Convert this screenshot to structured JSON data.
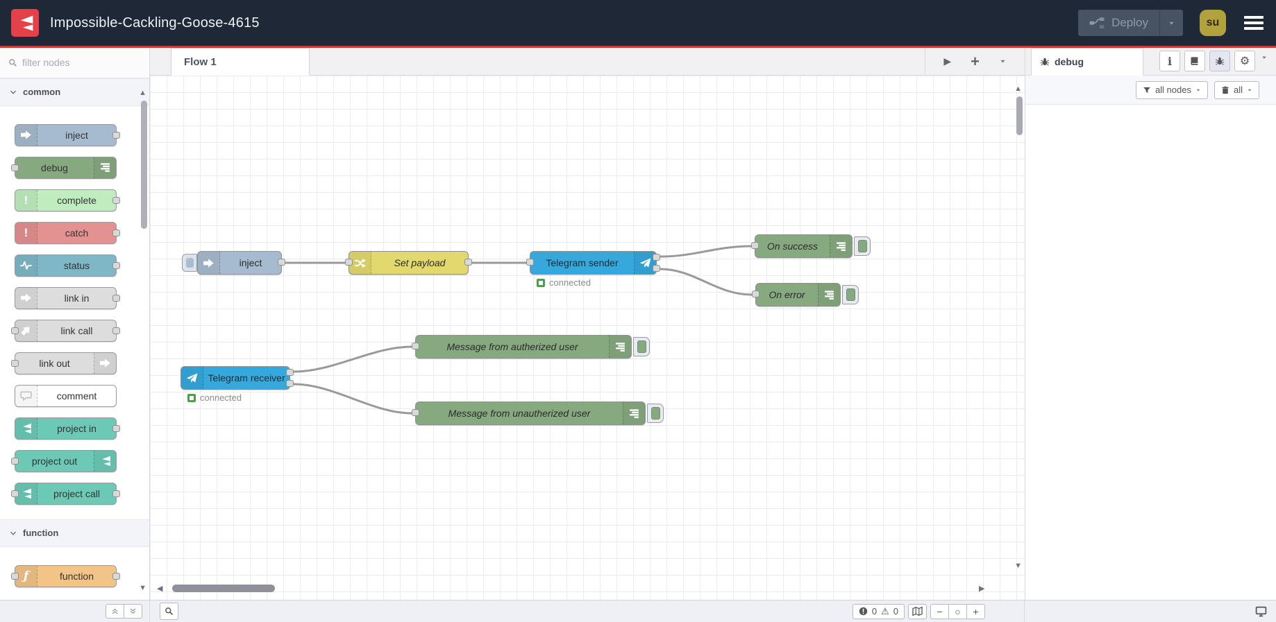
{
  "header": {
    "title": "Impossible-Cackling-Goose-4615",
    "deploy": {
      "label": "Deploy"
    },
    "avatar": {
      "initials": "su"
    }
  },
  "palette": {
    "filter_placeholder": "filter nodes",
    "categories": [
      {
        "label": "common",
        "nodes": [
          {
            "label": "inject",
            "color": "#a6bbcf",
            "icon": "inject-arrow-icon"
          },
          {
            "label": "debug",
            "color": "#87a980",
            "icon": "debug-list-icon"
          },
          {
            "label": "complete",
            "color": "#c0edc0",
            "icon": "exclamation-icon"
          },
          {
            "label": "catch",
            "color": "#e49191",
            "icon": "exclamation-icon"
          },
          {
            "label": "status",
            "color": "#7fb7c7",
            "icon": "pulse-icon"
          },
          {
            "label": "link in",
            "color": "#dddddd",
            "icon": "link-icon"
          },
          {
            "label": "link call",
            "color": "#dddddd",
            "icon": "link-icon"
          },
          {
            "label": "link out",
            "color": "#dddddd",
            "icon": "link-icon"
          },
          {
            "label": "comment",
            "color": "#ffffff",
            "icon": "comment-bubble-icon"
          },
          {
            "label": "project in",
            "color": "#6cc9b6",
            "icon": "project-icon"
          },
          {
            "label": "project out",
            "color": "#6cc9b6",
            "icon": "project-icon"
          },
          {
            "label": "project call",
            "color": "#6cc9b6",
            "icon": "project-icon"
          }
        ]
      },
      {
        "label": "function",
        "nodes": [
          {
            "label": "function",
            "color": "#f2c488",
            "icon": "function-icon"
          }
        ]
      }
    ]
  },
  "workspace": {
    "tab": "Flow 1",
    "nodes": [
      {
        "id": "inject",
        "label": "inject",
        "color": "#a6bbcf"
      },
      {
        "id": "set-payload",
        "label": "Set payload",
        "color": "#e2d96e"
      },
      {
        "id": "telegram-sender",
        "label": "Telegram sender",
        "color": "#36a8dc",
        "status": "connected"
      },
      {
        "id": "on-success",
        "label": "On success",
        "color": "#87a980"
      },
      {
        "id": "on-error",
        "label": "On error",
        "color": "#87a980"
      },
      {
        "id": "telegram-receiver",
        "label": "Telegram receiver",
        "color": "#36a8dc",
        "status": "connected"
      },
      {
        "id": "msg-authorized",
        "label": "Message from autherized user",
        "color": "#87a980"
      },
      {
        "id": "msg-unauthorized",
        "label": "Message from unautherized user",
        "color": "#87a980"
      }
    ],
    "footer": {
      "error_count": "0",
      "warning_count": "0"
    }
  },
  "sidebar": {
    "active_tab": "debug",
    "filter_button": "all nodes",
    "clear_button": "all",
    "tools": [
      "info",
      "help-book",
      "debug-bug",
      "config-gear"
    ]
  },
  "icons": {
    "warning_glyph": "⚠",
    "gear_glyph": "⚙",
    "play_glyph": "▶",
    "plus_glyph": "+",
    "minus_glyph": "−",
    "zoom_reset_glyph": "○",
    "left_arrow_glyph": "◀",
    "right_arrow_glyph": "▶",
    "up_arrow_glyph": "▲",
    "down_arrow_glyph": "▼",
    "exclamation_glyph": "!",
    "function_glyph": "ƒ",
    "info_glyph": "i"
  },
  "colors": {
    "header_bg": "#1e2836",
    "accent_red": "#c9393d",
    "logo_red": "#e5414b",
    "avatar_bg": "#b2a23e",
    "wire": "#999999",
    "node_inject": "#a6bbcf",
    "node_debug": "#87a980",
    "node_complete": "#c0edc0",
    "node_catch": "#e49191",
    "node_status": "#7fb7c7",
    "node_link": "#dddddd",
    "node_comment": "#ffffff",
    "node_project": "#6cc9b6",
    "node_function": "#f2c488",
    "node_change": "#e2d96e",
    "node_telegram": "#36a8dc",
    "status_connected": "#4c9e50"
  }
}
